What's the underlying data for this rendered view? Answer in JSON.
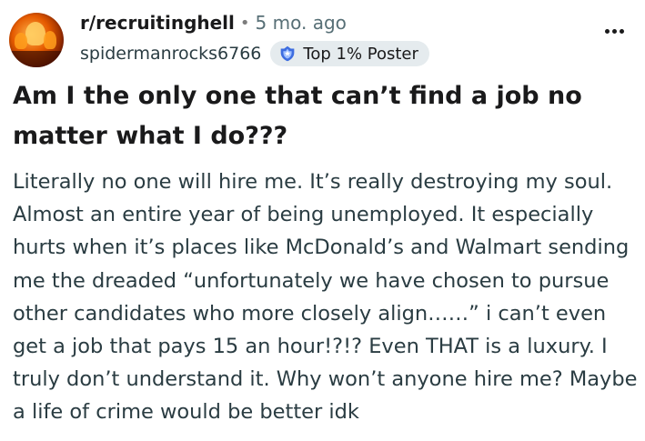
{
  "post": {
    "subreddit": "r/recruitinghell",
    "separator": "•",
    "time_ago": "5 mo. ago",
    "username": "spidermanrocks6766",
    "badge": {
      "label": "Top 1% Poster",
      "icon": "top-poster-icon"
    },
    "more_icon": "more-options-icon",
    "title": "Am I the only one that can’t find a job no matter what I do???",
    "body": "Literally no one will hire me. It’s really destroying my soul. Almost an entire year of being unemployed. It especially hurts when it’s places like McDonald’s and Walmart sending me the dreaded “unfortunately we have chosen to pursue other candidates who more closely align……” i can’t even get a job that pays 15 an hour!?!? Even THAT is a luxury. I truly don’t understand it. Why won’t anyone hire me? Maybe a life of crime would be better idk"
  },
  "colors": {
    "background": "#ffffff",
    "text_primary": "#1a1a1b",
    "text_secondary": "#576f76",
    "badge_bg": "#e5ebee",
    "badge_icon": "#3d6de0"
  }
}
